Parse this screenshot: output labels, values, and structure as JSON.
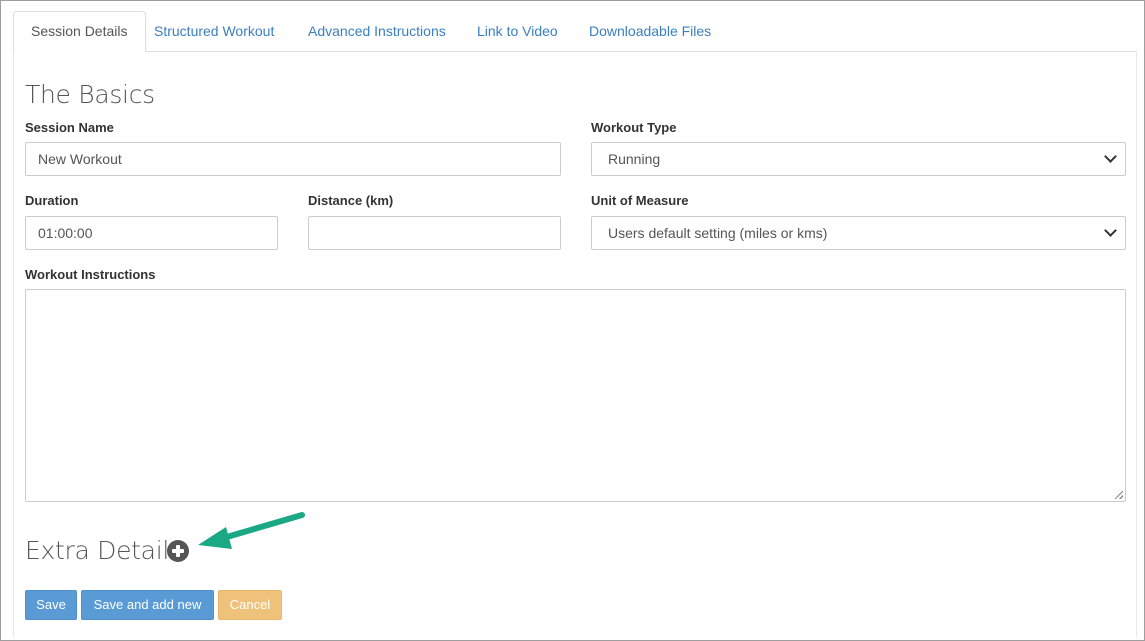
{
  "tabs": [
    {
      "label": "Session Details",
      "active": true
    },
    {
      "label": "Structured Workout",
      "active": false
    },
    {
      "label": "Advanced Instructions",
      "active": false
    },
    {
      "label": "Link to Video",
      "active": false
    },
    {
      "label": "Downloadable Files",
      "active": false
    }
  ],
  "basics": {
    "heading": "The Basics",
    "session_name_label": "Session Name",
    "session_name_value": "New Workout",
    "workout_type_label": "Workout Type",
    "workout_type_value": "Running",
    "duration_label": "Duration",
    "duration_value": "01:00:00",
    "distance_label": "Distance (km)",
    "distance_value": "",
    "unit_label": "Unit of Measure",
    "unit_value": "Users default setting (miles or kms)",
    "instructions_label": "Workout Instructions",
    "instructions_value": ""
  },
  "extra": {
    "heading": "Extra Details",
    "icon": "plus-circle-icon",
    "annotation_arrow_color": "#1aa885"
  },
  "actions": {
    "save_label": "Save",
    "save_add_label": "Save and add new",
    "cancel_label": "Cancel"
  },
  "colors": {
    "link": "#3a7fc1",
    "primary": "#5a9bd5",
    "warning": "#eec27a"
  }
}
